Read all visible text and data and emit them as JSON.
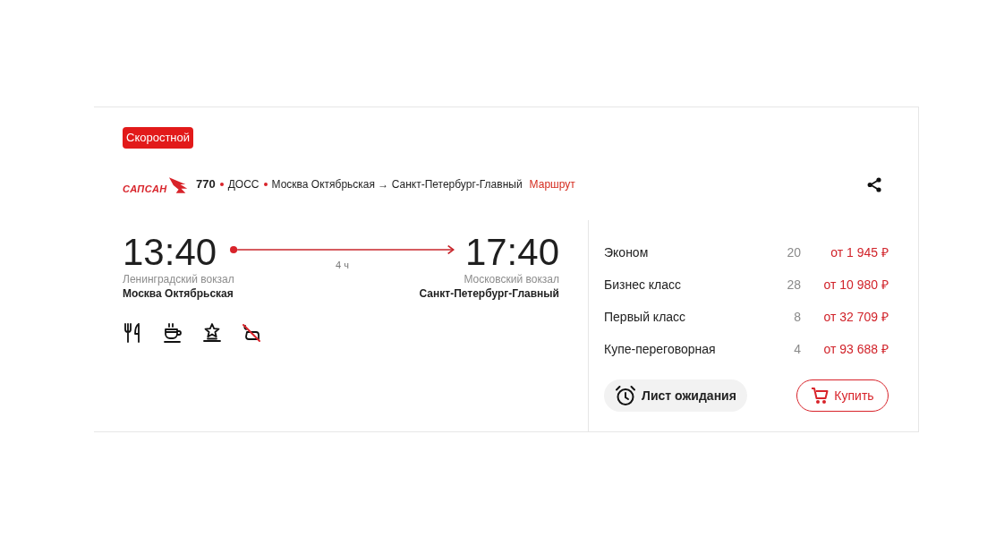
{
  "badge": "Скоростной",
  "train": {
    "brand_logo": "САПСАН",
    "number": "770",
    "category": "ДОСС",
    "route": "Москва Октябрьская → Санкт-Петербург-Главный",
    "route_link": "Маршрут"
  },
  "departure": {
    "time": "13:40",
    "station": "Ленинградский вокзал",
    "city": "Москва Октябрьская"
  },
  "duration": "4 ч",
  "arrival": {
    "time": "17:40",
    "station": "Московский вокзал",
    "city": "Санкт-Петербург-Главный"
  },
  "amenities": [
    {
      "kind": "meal",
      "available": true
    },
    {
      "kind": "coffee",
      "available": true
    },
    {
      "kind": "star",
      "available": true
    },
    {
      "kind": "pet",
      "available": false
    }
  ],
  "fares": [
    {
      "class": "Эконом",
      "seats": "20",
      "price": "от 1 945 ₽"
    },
    {
      "class": "Бизнес класс",
      "seats": "28",
      "price": "от 10 980 ₽"
    },
    {
      "class": "Первый класс",
      "seats": "8",
      "price": "от 32 709 ₽"
    },
    {
      "class": "Купе-переговорная",
      "seats": "4",
      "price": "от 93 688 ₽"
    }
  ],
  "buttons": {
    "waitlist": "Лист ожидания",
    "buy": "Купить"
  }
}
